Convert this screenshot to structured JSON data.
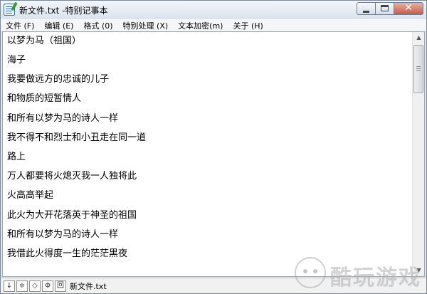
{
  "window": {
    "title": "新文件.txt -特别记事本"
  },
  "menu": [
    {
      "label": "文件 (F)"
    },
    {
      "label": "编辑 (E)"
    },
    {
      "label": "格式 (0)"
    },
    {
      "label": "特别处理 (X)"
    },
    {
      "label": "文本加密(m)"
    },
    {
      "label": "关于 (H)"
    }
  ],
  "editor": {
    "lines": [
      "以梦为马（祖国）",
      "海子",
      "我要做远方的忠诚的儿子",
      "和物质的短暂情人",
      "和所有以梦为马的诗人一样",
      "我不得不和烈士和小丑走在同一道",
      "路上",
      "万人都要将火熄灭我一人独将此",
      "火高高举起",
      "此火为大开花落英于神圣的祖国",
      "和所有以梦为马的诗人一样",
      "我借此火得度一生的茫茫黑夜"
    ]
  },
  "statusbar": {
    "buttons": [
      "↓",
      "≑",
      "◇",
      "Φ",
      "回"
    ],
    "filename": "新文件.txt"
  },
  "watermark": {
    "text": "酷玩游戏"
  }
}
